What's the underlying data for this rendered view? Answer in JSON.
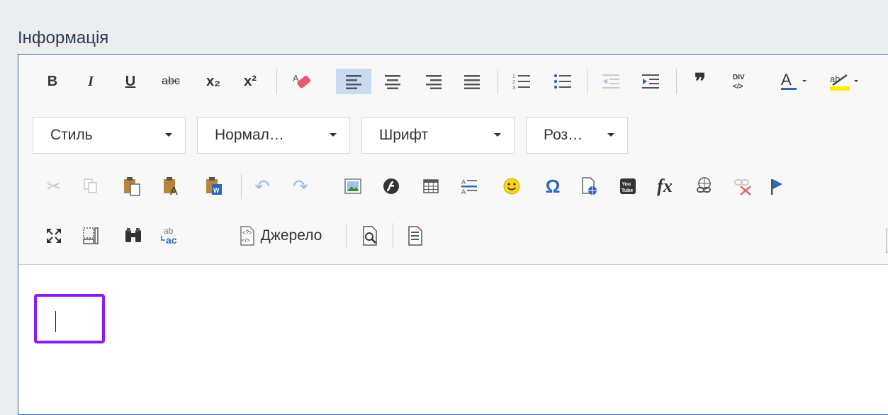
{
  "label": "Інформація",
  "formatting": {
    "bold": "B",
    "italic": "I",
    "underline": "U",
    "strike": "abc",
    "subscript": "x₂",
    "superscript": "x²"
  },
  "combos": {
    "style": "Стиль",
    "format": "Нормал…",
    "font": "Шрифт",
    "size": "Роз…"
  },
  "source_label": "Джерело",
  "colors": {
    "accent_border": "#2d68b8",
    "focus": "#8a1bf2",
    "active": "#c7dcf3"
  }
}
